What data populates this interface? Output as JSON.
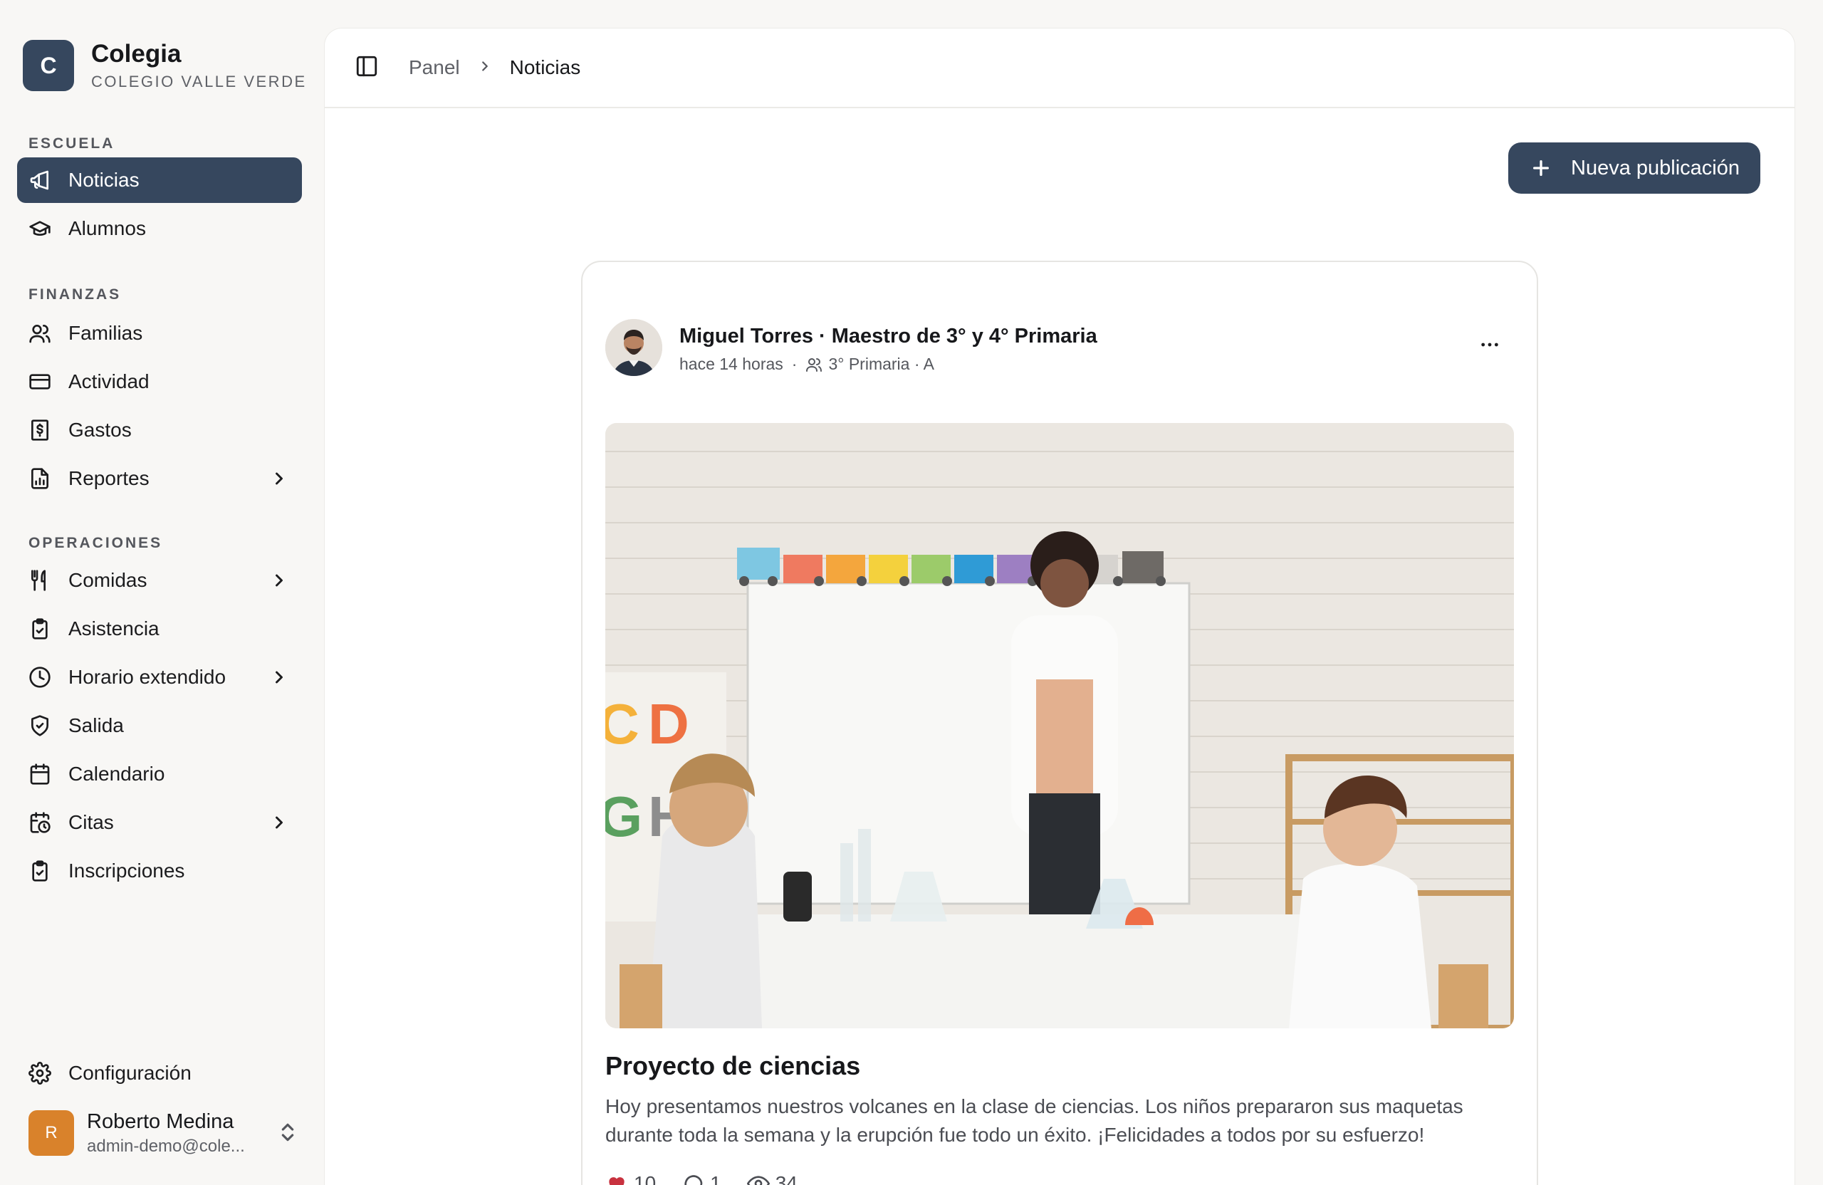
{
  "brand": {
    "logo_letter": "C",
    "name": "Colegia",
    "subtitle": "COLEGIO VALLE VERDE"
  },
  "sidebar": {
    "sections": [
      {
        "title": "ESCUELA",
        "items": [
          {
            "label": "Noticias",
            "icon": "megaphone-icon",
            "active": true
          },
          {
            "label": "Alumnos",
            "icon": "graduation-cap-icon"
          }
        ]
      },
      {
        "title": "FINANZAS",
        "items": [
          {
            "label": "Familias",
            "icon": "users-icon"
          },
          {
            "label": "Actividad",
            "icon": "credit-card-icon"
          },
          {
            "label": "Gastos",
            "icon": "receipt-icon"
          },
          {
            "label": "Reportes",
            "icon": "file-chart-icon",
            "submenu": true
          }
        ]
      },
      {
        "title": "OPERACIONES",
        "items": [
          {
            "label": "Comidas",
            "icon": "utensils-icon",
            "submenu": true
          },
          {
            "label": "Asistencia",
            "icon": "clipboard-check-icon"
          },
          {
            "label": "Horario extendido",
            "icon": "clock-icon",
            "submenu": true
          },
          {
            "label": "Salida",
            "icon": "shield-check-icon"
          },
          {
            "label": "Calendario",
            "icon": "calendar-icon"
          },
          {
            "label": "Citas",
            "icon": "calendar-clock-icon",
            "submenu": true
          },
          {
            "label": "Inscripciones",
            "icon": "clipboard-list-icon"
          }
        ]
      }
    ],
    "settings_label": "Configuración",
    "user": {
      "initial": "R",
      "name": "Roberto Medina",
      "email": "admin-demo@cole..."
    }
  },
  "topbar": {
    "breadcrumb_root": "Panel",
    "breadcrumb_current": "Noticias"
  },
  "actions": {
    "new_post_label": "Nueva publicación"
  },
  "post": {
    "author": "Miguel Torres · Maestro de 3° y 4° Primaria",
    "time": "hace 14 horas",
    "audience": "3° Primaria · A",
    "title": "Proyecto de ciencias",
    "body": "Hoy presentamos nuestros volcanes en la clase de ciencias. Los niños prepararon sus maquetas durante toda la semana y la erupción fue todo un éxito. ¡Felicidades a todos por su esfuerzo!",
    "likes": "10",
    "comments": "1",
    "views": "34"
  },
  "colors": {
    "primary": "#36475e",
    "like": "#c8323f",
    "avatar_user": "#d9822b"
  }
}
